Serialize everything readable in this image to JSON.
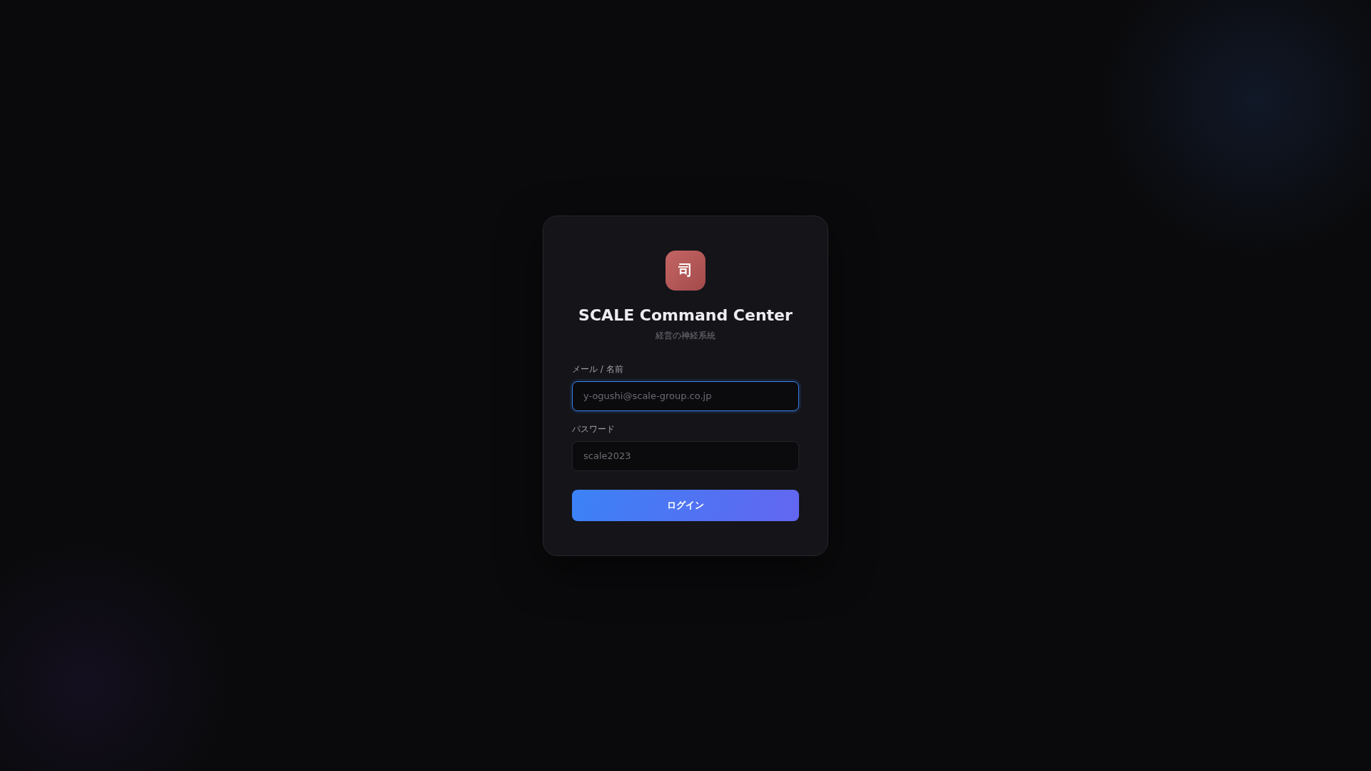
{
  "logo": {
    "glyph": "司"
  },
  "title": "SCALE Command Center",
  "subtitle": "経営の神経系統",
  "fields": [
    {
      "label": "メール / 名前",
      "placeholder": "y-ogushi@scale-group.co.jp",
      "focused": true
    },
    {
      "label": "パスワード",
      "placeholder": "scale2023",
      "focused": false
    }
  ],
  "button": {
    "label": "ログイン"
  }
}
